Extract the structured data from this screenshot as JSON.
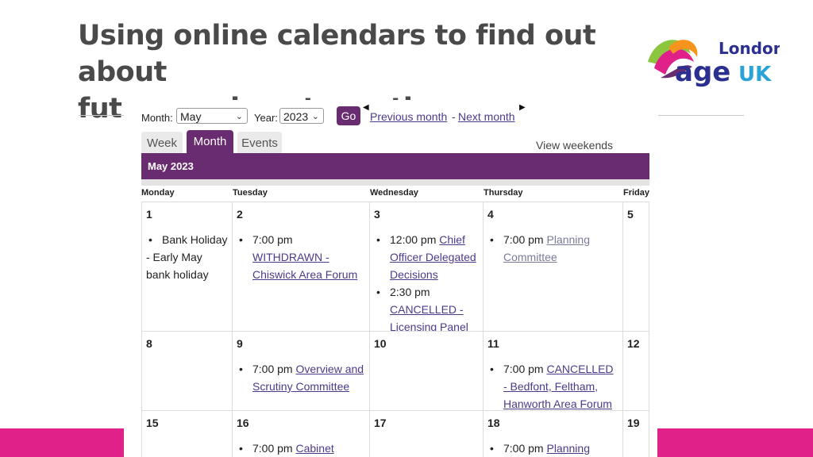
{
  "slide": {
    "title_line1": "Using online calendars to find out about",
    "title_line2": "future and past meetings",
    "logo": {
      "top_word": "London",
      "word_age": "age",
      "word_uk": "UK"
    }
  },
  "colors": {
    "brand_purple": "#6a2c70",
    "pink": "#e0218a",
    "link": "#4d3a8a"
  },
  "controls": {
    "month_label": "Month:",
    "month_value": "May",
    "year_label": "Year:",
    "year_value": "2023",
    "go": "Go",
    "previous": "Previous month",
    "separator": "-",
    "next": "Next month"
  },
  "tabs": [
    {
      "label": "Week"
    },
    {
      "label": "Month"
    },
    {
      "label": "Events"
    }
  ],
  "view_weekends": "View weekends",
  "month_title": "May 2023",
  "days": [
    "Monday",
    "Tuesday",
    "Wednesday",
    "Thursday",
    "Friday"
  ],
  "weeks": [
    {
      "cells": [
        {
          "day": "1",
          "events": [
            {
              "time": "Bank Holiday",
              "title": "- Early May bank holiday",
              "plain_block": true
            }
          ]
        },
        {
          "day": "2",
          "events": [
            {
              "time": "7:00 pm",
              "title": "WITHDRAWN - Chiswick Area Forum"
            }
          ]
        },
        {
          "day": "3",
          "events": [
            {
              "time": "12:00 pm",
              "title": "Chief Officer Delegated Decisions"
            },
            {
              "time": "2:30 pm",
              "title": "CANCELLED - Licensing Panel"
            }
          ]
        },
        {
          "day": "4",
          "events": [
            {
              "time": "7:00 pm",
              "title": "Planning Committee"
            }
          ]
        },
        {
          "day": "5",
          "events": []
        }
      ]
    },
    {
      "cells": [
        {
          "day": "8",
          "events": []
        },
        {
          "day": "9",
          "events": [
            {
              "time": "7:00 pm",
              "title": "Overview and Scrutiny Committee"
            }
          ]
        },
        {
          "day": "10",
          "events": []
        },
        {
          "day": "11",
          "events": [
            {
              "time": "7:00 pm",
              "title": "CANCELLED - Bedfont, Feltham, Hanworth Area Forum"
            }
          ]
        },
        {
          "day": "12",
          "events": []
        }
      ]
    },
    {
      "cells": [
        {
          "day": "15",
          "events": []
        },
        {
          "day": "16",
          "events": [
            {
              "time": "7:00 pm",
              "title": "Cabinet"
            }
          ]
        },
        {
          "day": "17",
          "events": []
        },
        {
          "day": "18",
          "events": [
            {
              "time": "7:00 pm",
              "title": "Planning"
            }
          ]
        },
        {
          "day": "19",
          "events": []
        }
      ]
    }
  ]
}
